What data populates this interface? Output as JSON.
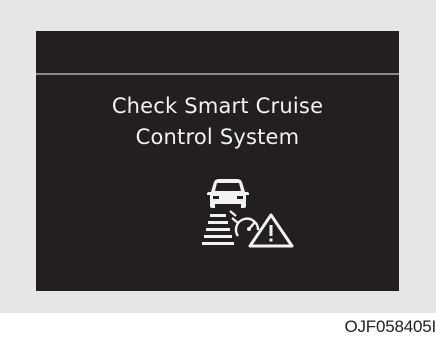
{
  "display": {
    "message_line1": "Check Smart Cruise",
    "message_line2": "Control System",
    "icon": "smart-cruise-warning-icon"
  },
  "figure_code": "OJF058405I",
  "colors": {
    "screen_background": "#231f20",
    "text": "#f2f2f2",
    "frame": "#e6e6e6"
  }
}
